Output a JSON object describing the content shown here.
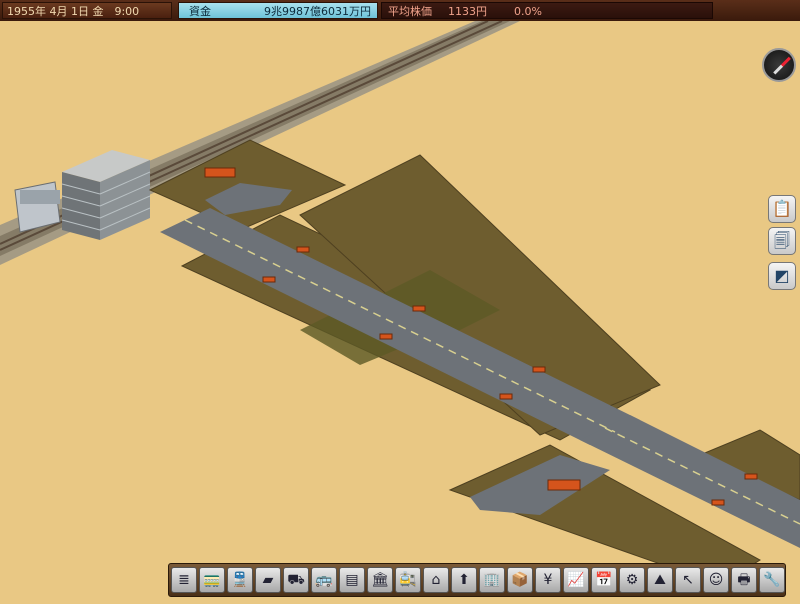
{
  "status": {
    "date": "1955年 4月 1日 金　9:00",
    "funds_label": "資金",
    "funds_value": "9兆9987億6031万円",
    "stock_label": "平均株価",
    "stock_value": "1133円",
    "stock_change": "0.0%"
  },
  "colors": {
    "ground": "#e9c884",
    "road": "#6d7278",
    "field": "#6b5a2c",
    "rail": "#8c8470",
    "bus_stop": "#d5541c"
  },
  "side_buttons": [
    {
      "name": "report-button",
      "icon": "clipboard-icon",
      "glyph": "📋"
    },
    {
      "name": "documents-button",
      "icon": "document-icon",
      "glyph": "🗐"
    },
    {
      "name": "display-toggle-button",
      "icon": "layer-icon",
      "glyph": "◩"
    }
  ],
  "toolbar": [
    {
      "name": "rail-tool",
      "glyph": "≣"
    },
    {
      "name": "train-tool",
      "glyph": "🚃"
    },
    {
      "name": "train-list-tool",
      "glyph": "🚆"
    },
    {
      "name": "road-tool",
      "glyph": "▰"
    },
    {
      "name": "road-building-tool",
      "glyph": "⛟"
    },
    {
      "name": "vehicle-tool",
      "glyph": "🚌"
    },
    {
      "name": "track-tool",
      "glyph": "▤"
    },
    {
      "name": "station-tool",
      "glyph": "🏛"
    },
    {
      "name": "station-building-tool",
      "glyph": "🚉"
    },
    {
      "name": "building-tool",
      "glyph": "⌂"
    },
    {
      "name": "terrain-tool",
      "glyph": "⬆"
    },
    {
      "name": "skyscraper-tool",
      "glyph": "🏢"
    },
    {
      "name": "cargo-tool",
      "glyph": "📦"
    },
    {
      "name": "finance-tool",
      "glyph": "¥"
    },
    {
      "name": "graph-tool",
      "glyph": "📈"
    },
    {
      "name": "calendar-tool",
      "glyph": "📅"
    },
    {
      "name": "settings-tool",
      "glyph": "⚙"
    },
    {
      "name": "landscape-tool",
      "glyph": "⛰"
    },
    {
      "name": "select-tool",
      "glyph": "↖"
    },
    {
      "name": "advisor-tool",
      "glyph": "☺"
    },
    {
      "name": "print-tool",
      "glyph": "🖶"
    },
    {
      "name": "options-tool",
      "glyph": "🔧"
    }
  ]
}
